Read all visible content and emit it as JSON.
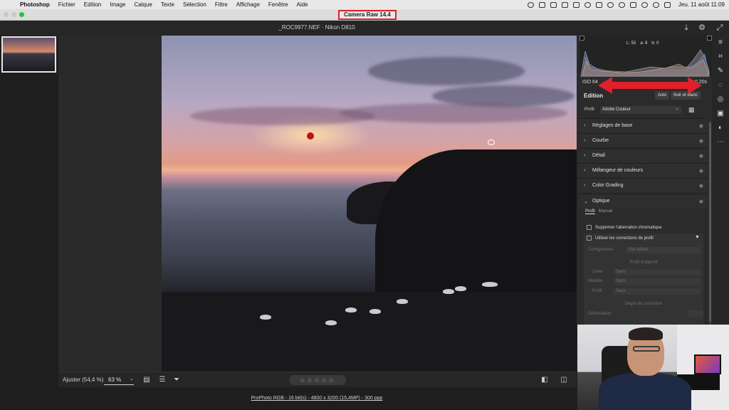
{
  "menubar": {
    "app_name": "Photoshop",
    "items": [
      "Fichier",
      "Edition",
      "Image",
      "Calque",
      "Texte",
      "Sélection",
      "Filtre",
      "Affichage",
      "Fenêtre",
      "Aide"
    ],
    "clock": "Jeu. 11 août  11:09"
  },
  "window": {
    "title": "Camera Raw 14.4"
  },
  "topbar": {
    "file_title": "_ROC9977.NEF  ·  Nikon D810"
  },
  "canvas_toolbar": {
    "fit_label": "Ajuster (54,4 %)",
    "zoom_value": "63 %",
    "stars": "☆☆☆☆☆"
  },
  "footer": {
    "color_info": "ProPhoto RGB - 16 bit(s) - 4800 x 3200 (15,4MP) - 300 ppp"
  },
  "panel": {
    "histogram_readout": {
      "r_label": "L:",
      "r_value": "52",
      "g_label": "a:",
      "g_value": "6",
      "b_label": "b:",
      "b_value": "0"
    },
    "iso": "ISO 64",
    "shutter": "0,20s",
    "edit_title": "Edition",
    "auto_label": "Auto",
    "bw_label": "Noir et blanc",
    "profile_label": "Profil",
    "profile_value": "Adobe Couleur",
    "sections": [
      "Réglages de base",
      "Courbe",
      "Détail",
      "Mélangeur de couleurs",
      "Color Grading",
      "Optique"
    ],
    "optics": {
      "tab_profile": "Profil",
      "tab_manual": "Manuel",
      "chromatic": "Supprimer l'aberration chromatique",
      "use_profile": "Utiliser les corrections de profil",
      "config_label": "Configuration",
      "config_value": "Par défaut",
      "lens_profile_title": "Profil d'objectif",
      "maker_label": "Créer",
      "maker_value": "Sans",
      "model_label": "Modèle",
      "model_value": "Sans",
      "profile_label": "Profil",
      "profile_value": "Sans",
      "degree_title": "Degré de correction",
      "distortion_label": "Déformation"
    }
  },
  "colors": {
    "annotation_red": "#e0202a",
    "accent_green": "#29c23f"
  }
}
